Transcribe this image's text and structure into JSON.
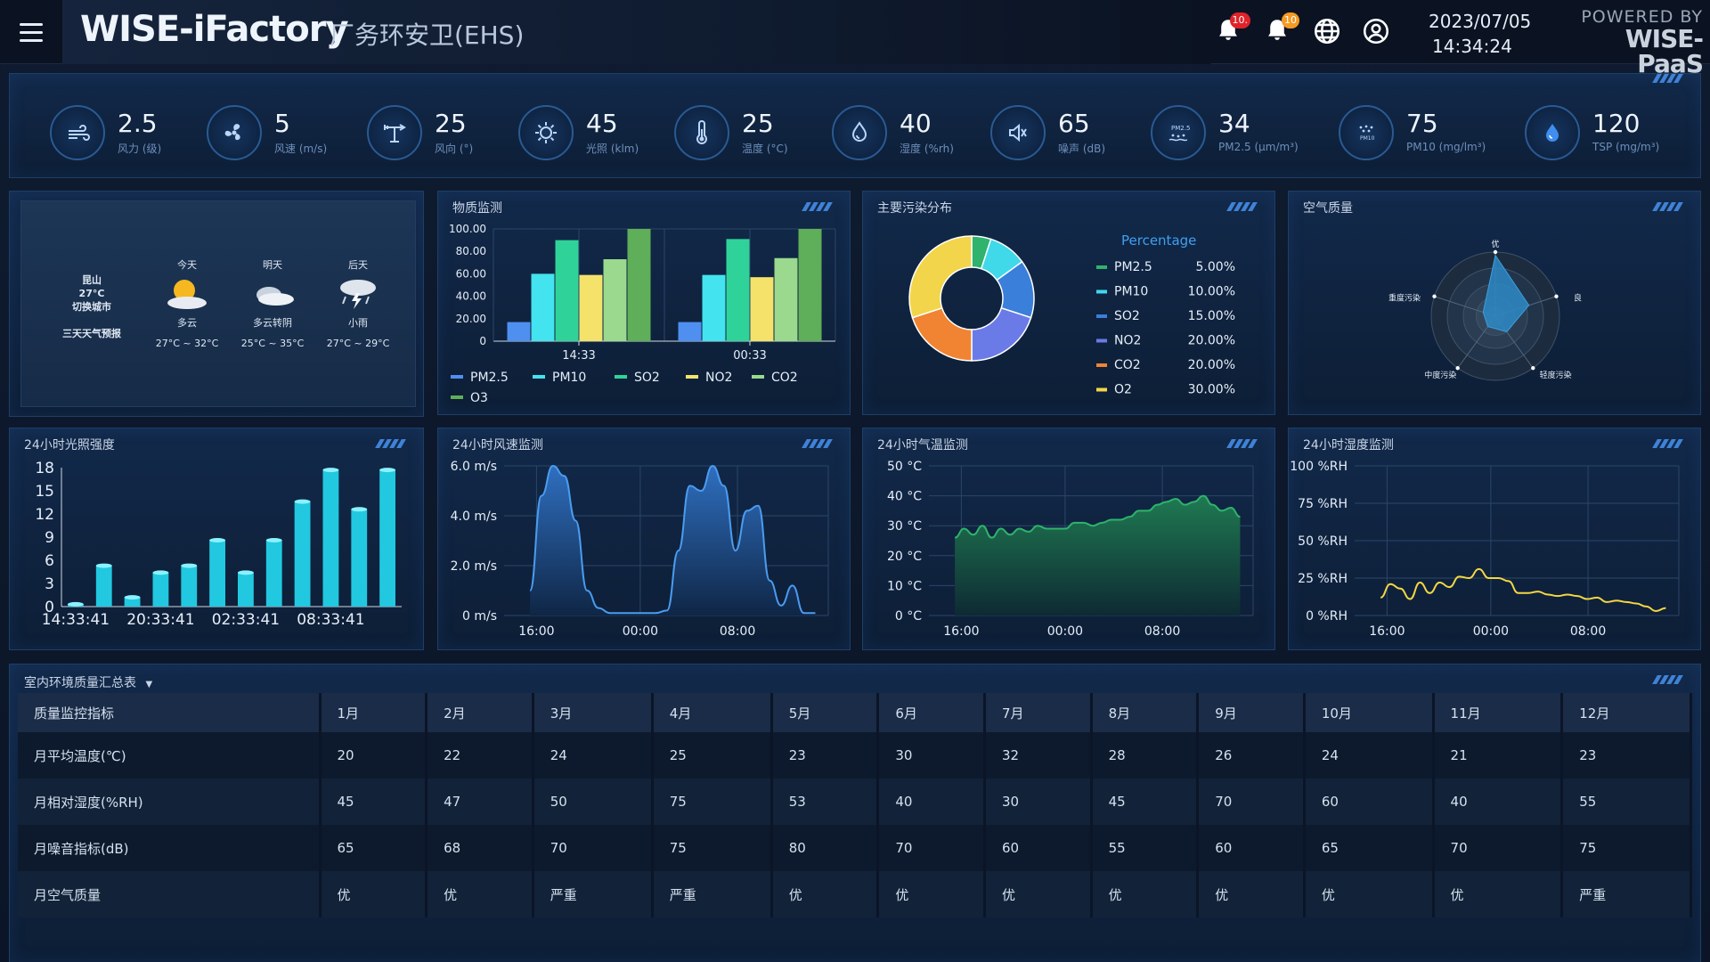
{
  "header": {
    "menu_icon": "hamburger-menu-icon",
    "title": "WISE-iFactory",
    "subtitle": "厂务环安卫(EHS)",
    "alarm_badge": "10.",
    "notify_badge": "10",
    "date": "2023/07/05",
    "time": "14:34:24",
    "powered_by": "POWERED BY",
    "powered_brand": "WISE-PaaS",
    "colors": {
      "alarm_badge": "#e0232a",
      "notify_badge": "#f59a23"
    }
  },
  "sensors": [
    {
      "icon": "wind-icon",
      "value": "2.5",
      "label": "风力 (级)"
    },
    {
      "icon": "fan-icon",
      "value": "5",
      "label": "风速 (m/s)"
    },
    {
      "icon": "wind-vane-icon",
      "value": "25",
      "label": "风向 (°)"
    },
    {
      "icon": "sun-icon",
      "value": "45",
      "label": "光照 (klm)"
    },
    {
      "icon": "thermometer-icon",
      "value": "25",
      "label": "温度 (°C)"
    },
    {
      "icon": "humidity-icon",
      "value": "40",
      "label": "湿度 (%rh)"
    },
    {
      "icon": "speaker-icon",
      "value": "65",
      "label": "噪声 (dB)"
    },
    {
      "icon": "pm25-icon",
      "value": "34",
      "label": "PM2.5 (μm/m³)"
    },
    {
      "icon": "pm10-icon",
      "value": "75",
      "label": "PM10 (mg/lm³)"
    },
    {
      "icon": "water-drop-icon",
      "value": "120",
      "label": "TSP (mg/m³)"
    }
  ],
  "weather": {
    "city": "昆山",
    "city_temp": "27°C",
    "switch_city": "切换城市",
    "forecast_label": "三天天气预报",
    "days": [
      {
        "day": "今天",
        "icon": "partly-cloudy-icon",
        "desc": "多云",
        "range": "27°C ~ 32°C"
      },
      {
        "day": "明天",
        "icon": "cloudy-icon",
        "desc": "多云转阴",
        "range": "25°C ~ 35°C"
      },
      {
        "day": "后天",
        "icon": "thunder-rain-icon",
        "desc": "小雨",
        "range": "27°C ~ 29°C"
      }
    ]
  },
  "panels": {
    "material": "物质监测",
    "pollutant": "主要污染分布",
    "air": "空气质量",
    "light": "24小时光照强度",
    "wind": "24小时风速监测",
    "temp": "24小时气温监测",
    "humidity": "24小时湿度监测",
    "table": "室内环境质量汇总表"
  },
  "chart_data": [
    {
      "id": "material",
      "type": "bar",
      "categories": [
        "14:33",
        "00:33"
      ],
      "ylim": [
        0,
        100
      ],
      "yticks": [
        "100.00",
        "80.00",
        "60.00",
        "40.00",
        "20.00",
        "0"
      ],
      "series": [
        {
          "name": "PM2.5",
          "color": "#4f8ff0",
          "values": [
            17,
            17
          ]
        },
        {
          "name": "PM10",
          "color": "#43e3f0",
          "values": [
            60,
            59
          ]
        },
        {
          "name": "SO2",
          "color": "#2fd399",
          "values": [
            90,
            91
          ]
        },
        {
          "name": "NO2",
          "color": "#f4e26a",
          "values": [
            59,
            57
          ]
        },
        {
          "name": "CO2",
          "color": "#9ad98e",
          "values": [
            73,
            74
          ]
        },
        {
          "name": "O3",
          "color": "#5fae59",
          "values": [
            100,
            100
          ]
        }
      ]
    },
    {
      "id": "pollutant",
      "type": "pie",
      "legend_title": "Percentage",
      "slices": [
        {
          "name": "PM2.5",
          "value": 5,
          "label": "5.00%",
          "color": "#2fb36d"
        },
        {
          "name": "PM10",
          "value": 10,
          "label": "10.00%",
          "color": "#3fd9ea"
        },
        {
          "name": "SO2",
          "value": 15,
          "label": "15.00%",
          "color": "#3a7fd9"
        },
        {
          "name": "NO2",
          "value": 20,
          "label": "20.00%",
          "color": "#6a7be8"
        },
        {
          "name": "CO2",
          "value": 20,
          "label": "20.00%",
          "color": "#f08432"
        },
        {
          "name": "O2",
          "value": 30,
          "label": "30.00%",
          "color": "#f2d54a"
        }
      ]
    },
    {
      "id": "air",
      "type": "radar",
      "axes": [
        "优",
        "良",
        "轻度污染",
        "中度污染",
        "重度污染"
      ],
      "values": [
        0.95,
        0.55,
        0.3,
        0.2,
        0.2
      ]
    },
    {
      "id": "light",
      "type": "bar",
      "x_labels": [
        "14:33:41",
        "20:33:41",
        "02:33:41",
        "08:33:41"
      ],
      "yticks": [
        "18",
        "15",
        "12",
        "9",
        "6",
        "3",
        "0"
      ],
      "ylim": [
        0,
        18
      ],
      "values": [
        0.3,
        5.3,
        1.2,
        4.4,
        5.3,
        8.6,
        4.4,
        8.6,
        13.6,
        17.7,
        12.6,
        17.7
      ]
    },
    {
      "id": "wind",
      "type": "area",
      "yticks": [
        "6.0 m/s",
        "4.0 m/s",
        "2.0 m/s",
        "0 m/s"
      ],
      "ylim": [
        0,
        6
      ],
      "x_labels": [
        "16:00",
        "00:00",
        "08:00"
      ],
      "values": [
        1,
        4.8,
        6,
        5.6,
        3.8,
        1,
        0.3,
        0.1,
        0.1,
        0.1,
        0.1,
        0.1,
        0.2,
        2.6,
        5.2,
        5,
        6,
        5.2,
        2.6,
        4.2,
        4.4,
        1.4,
        0.4,
        1.2,
        0.1,
        0.1
      ]
    },
    {
      "id": "temp",
      "type": "area",
      "yticks": [
        "50 °C",
        "40 °C",
        "30 °C",
        "20 °C",
        "10 °C",
        "0 °C"
      ],
      "ylim": [
        0,
        50
      ],
      "x_labels": [
        "16:00",
        "00:00",
        "08:00"
      ],
      "values": [
        26,
        29,
        27,
        30,
        26,
        29,
        27,
        29,
        28,
        30,
        29,
        29,
        29,
        31,
        31,
        30,
        31,
        32,
        32,
        33,
        35,
        35,
        37,
        38,
        39,
        37,
        38,
        40,
        37,
        35,
        36,
        33
      ]
    },
    {
      "id": "humidity",
      "type": "line",
      "yticks": [
        "100 %RH",
        "75 %RH",
        "50 %RH",
        "25 %RH",
        "0 %RH"
      ],
      "ylim": [
        0,
        100
      ],
      "x_labels": [
        "16:00",
        "00:00",
        "08:00"
      ],
      "values": [
        12,
        21,
        18,
        11,
        22,
        15,
        22,
        19,
        26,
        25,
        31,
        25,
        25,
        23,
        15,
        15,
        16,
        14,
        13,
        14,
        13,
        11,
        12,
        9,
        10,
        9,
        8,
        6,
        3,
        5
      ]
    }
  ],
  "table": {
    "headers": [
      "质量监控指标",
      "1月",
      "2月",
      "3月",
      "4月",
      "5月",
      "6月",
      "7月",
      "8月",
      "9月",
      "10月",
      "11月",
      "12月"
    ],
    "rows": [
      {
        "name": "月平均温度(℃)",
        "cells": [
          {
            "v": "20"
          },
          {
            "v": "22"
          },
          {
            "v": "24"
          },
          {
            "v": "25"
          },
          {
            "v": "23"
          },
          {
            "v": "30"
          },
          {
            "v": "32"
          },
          {
            "v": "28"
          },
          {
            "v": "26"
          },
          {
            "v": "24"
          },
          {
            "v": "21"
          },
          {
            "v": "23"
          }
        ]
      },
      {
        "name": "月相对湿度(%RH)",
        "cells": [
          {
            "v": "45"
          },
          {
            "v": "47"
          },
          {
            "v": "50"
          },
          {
            "v": "75",
            "c": "hl"
          },
          {
            "v": "53"
          },
          {
            "v": "40"
          },
          {
            "v": "30"
          },
          {
            "v": "45"
          },
          {
            "v": "70"
          },
          {
            "v": "60"
          },
          {
            "v": "40"
          },
          {
            "v": "55"
          }
        ]
      },
      {
        "name": "月噪音指标(dB)",
        "cells": [
          {
            "v": "65"
          },
          {
            "v": "68"
          },
          {
            "v": "70"
          },
          {
            "v": "75"
          },
          {
            "v": "80",
            "c": "warn"
          },
          {
            "v": "70"
          },
          {
            "v": "60"
          },
          {
            "v": "55"
          },
          {
            "v": "60"
          },
          {
            "v": "65"
          },
          {
            "v": "70"
          },
          {
            "v": "75"
          }
        ]
      },
      {
        "name": "月空气质量",
        "cells": [
          {
            "v": "优",
            "c": "good"
          },
          {
            "v": "优",
            "c": "good"
          },
          {
            "v": "严重",
            "c": "bad"
          },
          {
            "v": "严重",
            "c": "bad"
          },
          {
            "v": "优",
            "c": "good"
          },
          {
            "v": "优",
            "c": "good"
          },
          {
            "v": "优",
            "c": "good"
          },
          {
            "v": "优",
            "c": "good"
          },
          {
            "v": "优",
            "c": "good"
          },
          {
            "v": "优",
            "c": "good"
          },
          {
            "v": "优",
            "c": "good"
          },
          {
            "v": "严重",
            "c": "bad"
          }
        ]
      }
    ]
  }
}
